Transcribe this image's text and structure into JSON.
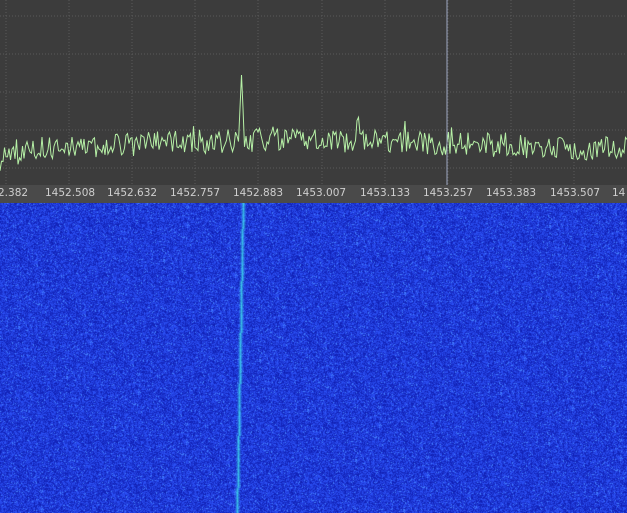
{
  "spectrum": {
    "background_color": "#3c3c3c",
    "grid_color": "#5a5a5a",
    "trace_color": "#b6f0a6",
    "marker_color": "#9ea7c2",
    "marker_frequency": "1453.257"
  },
  "frequency_axis": {
    "labels": [
      "2.382",
      "1452.508",
      "1452.632",
      "1452.757",
      "1452.883",
      "1453.007",
      "1453.133",
      "1453.257",
      "1453.383",
      "1453.507",
      "14"
    ]
  },
  "waterfall": {
    "background_color": "#1226c8",
    "signal_color": "#3cc8f0",
    "signal_frequency": "1452.883"
  }
}
